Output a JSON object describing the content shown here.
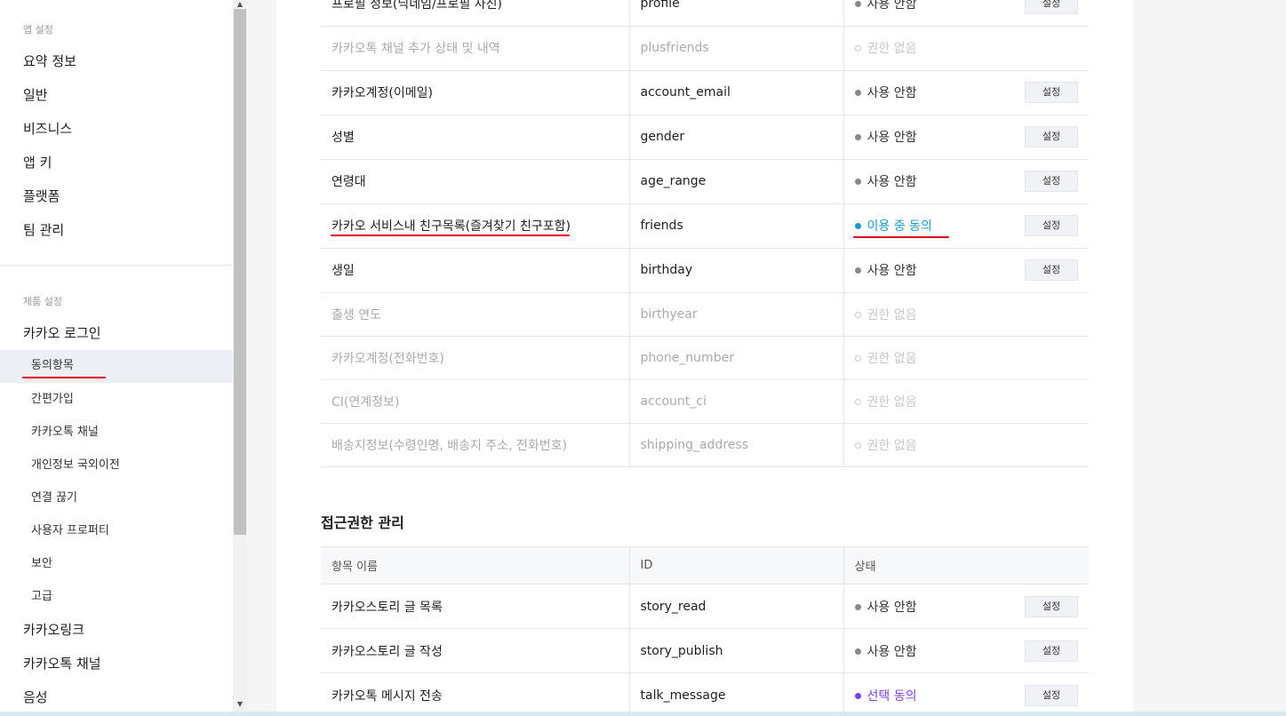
{
  "sidebar": {
    "app_settings_label": "앱 설정",
    "app_items": [
      "요약 정보",
      "일반",
      "비즈니스",
      "앱 키",
      "플랫폼",
      "팀 관리"
    ],
    "product_settings_label": "제품 설정",
    "kakao_login": "카카오 로그인",
    "login_sub_items": [
      "동의항목",
      "간편가입",
      "카카오톡 채널",
      "개인정보 국외이전",
      "연결 끊기",
      "사용자 프로퍼티",
      "보안",
      "고급"
    ],
    "more_items": [
      "카카오링크",
      "카카오톡 채널",
      "음성"
    ]
  },
  "consent_table": {
    "rows": [
      {
        "name": "프로필 정보(닉네임/프로필 사진)",
        "id": "profile",
        "status": "사용 안함",
        "type": "gray",
        "button": "설정"
      },
      {
        "name": "카카오톡 채널 추가 상태 및 내역",
        "id": "plusfriends",
        "status": "권한 없음",
        "type": "none",
        "button": ""
      },
      {
        "name": "카카오계정(이메일)",
        "id": "account_email",
        "status": "사용 안함",
        "type": "gray",
        "button": "설정"
      },
      {
        "name": "성별",
        "id": "gender",
        "status": "사용 안함",
        "type": "gray",
        "button": "설정"
      },
      {
        "name": "연령대",
        "id": "age_range",
        "status": "사용 안함",
        "type": "gray",
        "button": "설정"
      },
      {
        "name": "카카오 서비스내 친구목록(즐겨찾기 친구포함)",
        "id": "friends",
        "status": "이용 중 동의",
        "type": "blue",
        "button": "설정"
      },
      {
        "name": "생일",
        "id": "birthday",
        "status": "사용 안함",
        "type": "gray",
        "button": "설정"
      },
      {
        "name": "출생 연도",
        "id": "birthyear",
        "status": "권한 없음",
        "type": "none",
        "button": ""
      },
      {
        "name": "카카오계정(전화번호)",
        "id": "phone_number",
        "status": "권한 없음",
        "type": "none",
        "button": ""
      },
      {
        "name": "CI(연계정보)",
        "id": "account_ci",
        "status": "권한 없음",
        "type": "none",
        "button": ""
      },
      {
        "name": "배송지정보(수령인명, 배송지 주소, 전화번호)",
        "id": "shipping_address",
        "status": "권한 없음",
        "type": "none",
        "button": ""
      }
    ]
  },
  "access_section": {
    "title": "접근권한 관리",
    "headers": [
      "항목 이름",
      "ID",
      "상태"
    ],
    "rows": [
      {
        "name": "카카오스토리 글 목록",
        "id": "story_read",
        "status": "사용 안함",
        "type": "gray",
        "button": "설정"
      },
      {
        "name": "카카오스토리 글 작성",
        "id": "story_publish",
        "status": "사용 안함",
        "type": "gray",
        "button": "설정"
      },
      {
        "name": "카카오톡 메시지 전송",
        "id": "talk_message",
        "status": "선택 동의",
        "type": "purple",
        "button": "설정"
      }
    ]
  },
  "colors": {
    "accent_blue": "#1a9bd0",
    "accent_purple": "#7b3ff5",
    "annotation_red": "#e0001b"
  }
}
